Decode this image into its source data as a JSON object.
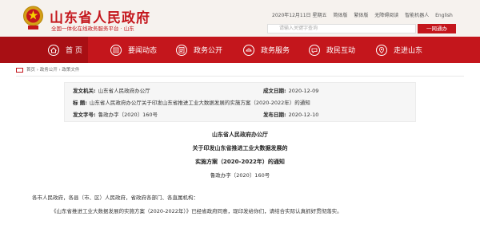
{
  "header": {
    "site_title": "山东省人民政府",
    "site_subtitle": "全国一体化在线政务服务平台 · 山东",
    "topbar": [
      "2020年12月11日 星期五",
      "简体版",
      "繁体版",
      "无障碍阅读",
      "智能机器人",
      "English"
    ],
    "search_placeholder": "请输入关键字查询",
    "search_button": "一网通办"
  },
  "nav": {
    "items": [
      {
        "label": "首  页",
        "icon": "home-icon"
      },
      {
        "label": "要闻动态",
        "icon": "news-icon"
      },
      {
        "label": "政务公开",
        "icon": "open-gov-icon"
      },
      {
        "label": "政务服务",
        "icon": "service-icon"
      },
      {
        "label": "政民互动",
        "icon": "interaction-icon"
      },
      {
        "label": "走进山东",
        "icon": "shandong-icon"
      }
    ]
  },
  "breadcrumb": "首页 › 政务公开 › 政策文件",
  "info": {
    "issuer_label": "发文机关:",
    "issuer": "山东省人民政府办公厅",
    "date_label": "成文日期:",
    "date": "2020-12-09",
    "title_label": "标    题:",
    "title": "山东省人民政府办公厅关于印发山东省推进工业大数据发展的实施方案（2020-2022年）的通知",
    "docno_label": "发文字号:",
    "docno": "鲁政办字〔2020〕160号",
    "pubdate_label": "发布日期:",
    "pubdate": "2020-12-10"
  },
  "document": {
    "org": "山东省人民政府办公厅",
    "title_line1": "关于印发山东省推进工业大数据发展的",
    "title_line2": "实施方案（2020-2022年）的通知",
    "number": "鲁政办字〔2020〕160号",
    "salutation": "各市人民政府，各县（市、区）人民政府，省政府各部门、各直属机构：",
    "body": "《山东省推进工业大数据发展的实施方案（2020-2022年）》已经省政府同意，现印发给你们，请结合实际认真抓好贯彻落实。"
  },
  "colors": {
    "brand_red": "#c4161c",
    "header_bg": "#f6f2ee"
  }
}
